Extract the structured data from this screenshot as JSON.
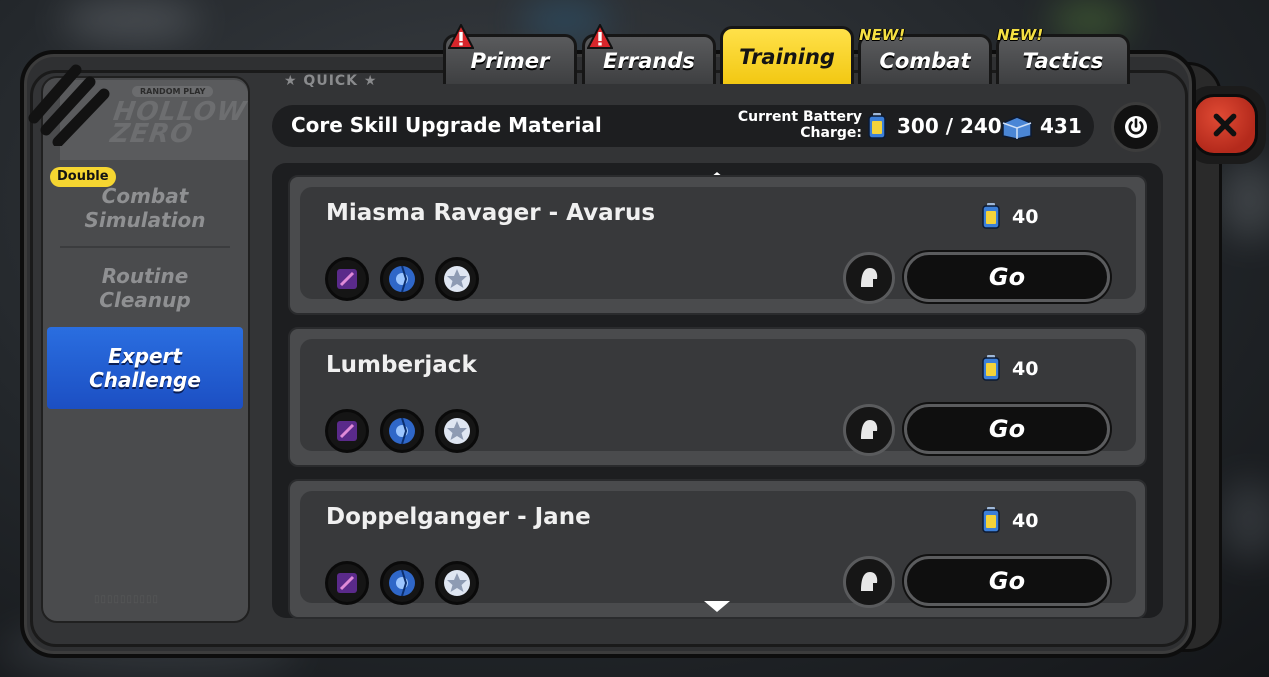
{
  "tabs": [
    {
      "label": "Primer",
      "alert": true,
      "new": false,
      "active": false
    },
    {
      "label": "Errands",
      "alert": true,
      "new": false,
      "active": false
    },
    {
      "label": "Training",
      "alert": false,
      "new": false,
      "active": true
    },
    {
      "label": "Combat",
      "alert": false,
      "new": true,
      "active": false
    },
    {
      "label": "Tactics",
      "alert": false,
      "new": true,
      "active": false
    }
  ],
  "new_badge": "NEW!",
  "quick_label": "★ QUICK ★",
  "sidebar": {
    "random_play": "RANDOM PLAY",
    "logo_text": "HOLLOW ZERO",
    "double_badge": "Double",
    "items": [
      {
        "label_line1": "Combat",
        "label_line2": "Simulation",
        "active": false
      },
      {
        "label_line1": "Routine",
        "label_line2": "Cleanup",
        "active": false
      },
      {
        "label_line1": "Expert",
        "label_line2": "Challenge",
        "active": true
      }
    ]
  },
  "header": {
    "title": "Core Skill Upgrade Material",
    "battery_label_line1": "Current Battery",
    "battery_label_line2": "Charge:",
    "battery_value": "300 / 240",
    "reserve_value": "431"
  },
  "entries": [
    {
      "title": "Miasma Ravager - Avarus",
      "cost": "40",
      "go_label": "Go"
    },
    {
      "title": "Lumberjack",
      "cost": "40",
      "go_label": "Go"
    },
    {
      "title": "Doppelganger - Jane",
      "cost": "40",
      "go_label": "Go"
    }
  ],
  "colors": {
    "accent_tab": "#f5d020",
    "active_sidebar": "#2563d6",
    "close_button": "#c8331f",
    "double_badge": "#f6d631"
  }
}
